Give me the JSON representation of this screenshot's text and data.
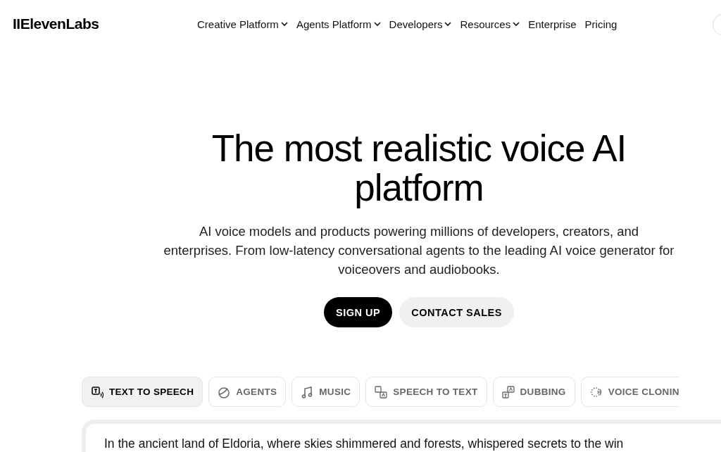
{
  "logo": "IIElevenLabs",
  "nav": [
    {
      "label": "Creative Platform",
      "dropdown": true
    },
    {
      "label": "Agents Platform",
      "dropdown": true
    },
    {
      "label": "Developers",
      "dropdown": true
    },
    {
      "label": "Resources",
      "dropdown": true
    },
    {
      "label": "Enterprise",
      "dropdown": false
    },
    {
      "label": "Pricing",
      "dropdown": false
    }
  ],
  "hero": {
    "title": "The most realistic voice AI platform",
    "subtitle": "AI voice models and products powering millions of developers, creators, and enterprises. From low-latency conversational agents to the leading AI voice generator for voiceovers and audiobooks."
  },
  "buttons": [
    {
      "label": "SIGN UP",
      "kind": "primary"
    },
    {
      "label": "CONTACT SALES",
      "kind": "secondary"
    }
  ],
  "tabs": [
    {
      "label": "TEXT TO SPEECH",
      "kind": "tts",
      "selected": true
    },
    {
      "label": "AGENTS",
      "kind": "agents",
      "selected": false
    },
    {
      "label": "MUSIC",
      "kind": "music",
      "selected": false
    },
    {
      "label": "SPEECH TO TEXT",
      "kind": "stt",
      "selected": false
    },
    {
      "label": "DUBBING",
      "kind": "dubbing",
      "selected": false
    },
    {
      "label": "VOICE CLONIN",
      "kind": "cloning",
      "selected": false
    }
  ],
  "editor": {
    "text": "In the ancient land of Eldoria, where skies shimmered and forests, whispered secrets to the win"
  }
}
